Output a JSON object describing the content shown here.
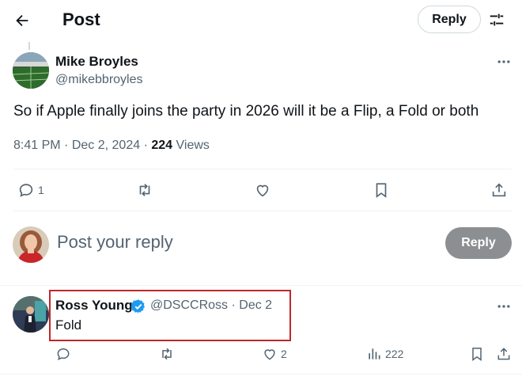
{
  "header": {
    "title": "Post",
    "reply_label": "Reply"
  },
  "post": {
    "author_name": "Mike Broyles",
    "author_handle": "@mikebbroyles",
    "text": "So if Apple finally joins the party in 2026 will it be a Flip, a Fold or both",
    "time": "8:41 PM",
    "date": "Dec 2, 2024",
    "views_count": "224",
    "views_label": "Views",
    "actions": {
      "reply_count": "1",
      "repost_count": "",
      "like_count": "",
      "bookmark_count": ""
    }
  },
  "composer": {
    "placeholder": "Post your reply",
    "reply_button": "Reply"
  },
  "reply": {
    "author_name": "Ross Young",
    "author_handle": "@DSCCRoss",
    "date": "Dec 2",
    "text": "Fold",
    "actions": {
      "reply_count": "",
      "repost_count": "",
      "like_count": "2",
      "views_count": "222"
    }
  },
  "colors": {
    "text_primary": "#0f1419",
    "text_secondary": "#536471",
    "verified": "#1d9bf0",
    "highlight": "#c0282a",
    "disabled_button": "#8b8f92"
  },
  "icons": [
    "back-arrow-icon",
    "tune-icon",
    "more-icon",
    "reply-icon",
    "repost-icon",
    "like-icon",
    "bookmark-icon",
    "share-icon",
    "views-icon",
    "verified-icon"
  ]
}
